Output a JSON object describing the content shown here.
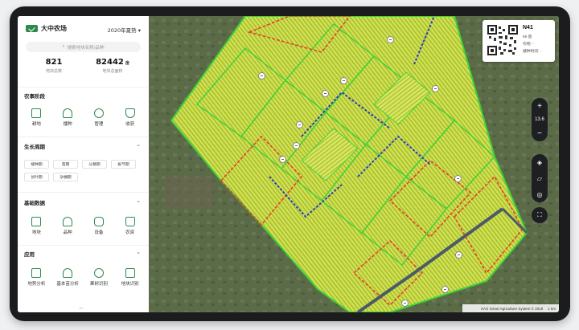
{
  "sidebar": {
    "farm_name": "大中农场",
    "season": "2020年夏熟",
    "search_placeholder": "搜索地块名称/品种",
    "stats": [
      {
        "value": "821",
        "unit": "",
        "label": "地块总数"
      },
      {
        "value": "82442",
        "unit": "亩",
        "label": "地块总面积"
      }
    ],
    "sections": {
      "farming_stage": {
        "title": "农事阶段",
        "items": [
          {
            "label": "耕地",
            "icon": "tillage-icon"
          },
          {
            "label": "播种",
            "icon": "sowing-icon"
          },
          {
            "label": "管理",
            "icon": "management-icon"
          },
          {
            "label": "收获",
            "icon": "harvest-icon"
          }
        ]
      },
      "growth_cycle": {
        "title": "生长周期",
        "chips": [
          "播种期",
          "苗期",
          "分蘖期",
          "拔节期",
          "创叶期",
          "孕穗期"
        ]
      },
      "basic_data": {
        "title": "基础数据",
        "items": [
          {
            "label": "地块",
            "icon": "plot-icon"
          },
          {
            "label": "品种",
            "icon": "variety-icon"
          },
          {
            "label": "设备",
            "icon": "device-icon"
          },
          {
            "label": "农资",
            "icon": "supplies-icon"
          }
        ]
      },
      "apps": {
        "title": "应用",
        "items": [
          {
            "label": "地势分析",
            "icon": "terrain-analysis-icon"
          },
          {
            "label": "基本苗分析",
            "icon": "seedling-analysis-icon"
          },
          {
            "label": "果树识别",
            "icon": "fruit-tree-icon"
          },
          {
            "label": "地块识别",
            "icon": "plot-recognition-icon"
          }
        ]
      }
    },
    "collapse_icon": "chevron-up-icon"
  },
  "map": {
    "card": {
      "title": "N41",
      "line1": "69 亩",
      "line2_label": "作物:",
      "line2_value": "-",
      "line3_label": "播种时间:",
      "line3_value": "-"
    },
    "zoom_in": "+",
    "zoom_level": "13.6",
    "zoom_out": "−",
    "footer_credit": "XAG Smart Agriculture System © 2019",
    "scale_label": "1 km"
  },
  "colors": {
    "accent": "#2e8a4a",
    "field_yellow": "#cfe24a",
    "border_green": "#3bd13b",
    "border_red": "#e8402a",
    "border_blue": "#2a3fb8"
  }
}
